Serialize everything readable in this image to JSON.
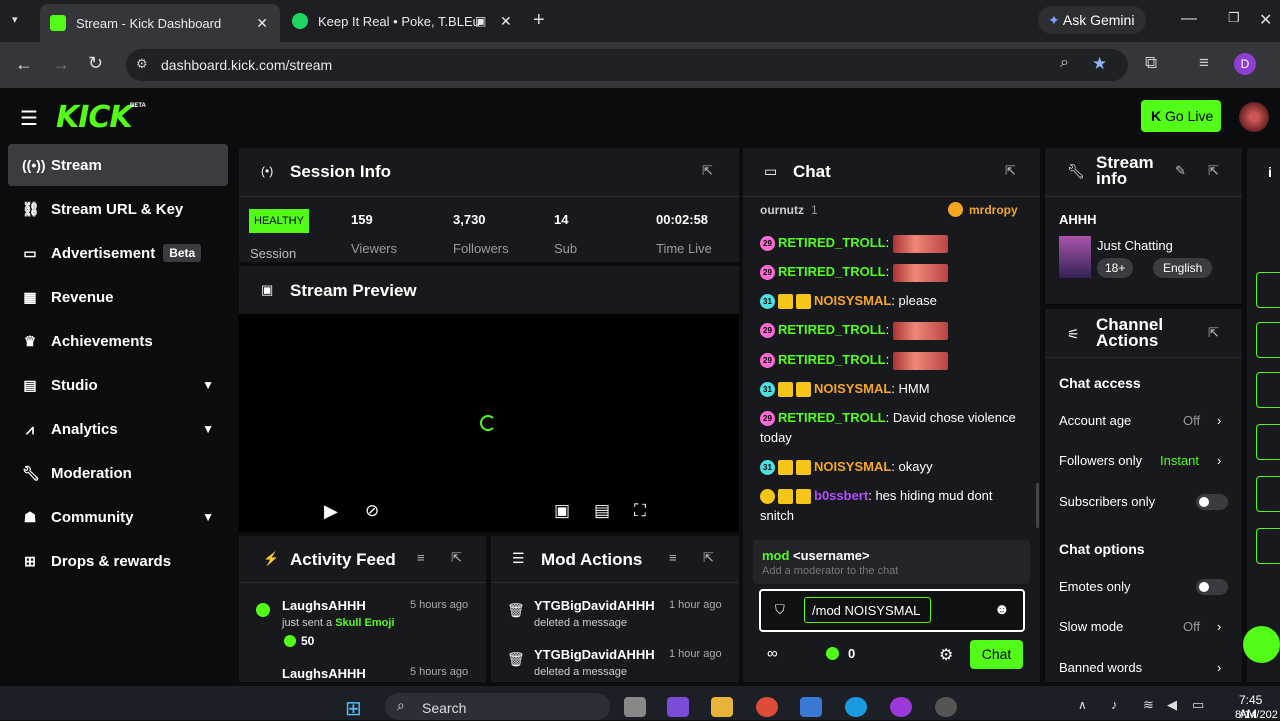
{
  "browser": {
    "tabs": [
      {
        "title": "Stream - Kick Dashboard"
      },
      {
        "title": "Keep It Real • Poke, T.BLEu"
      }
    ],
    "ask_gemini": "Ask Gemini",
    "url": "dashboard.kick.com/stream",
    "profile_initial": "D"
  },
  "header": {
    "logo": "KICK",
    "beta": "BETA",
    "go_live": "Go Live"
  },
  "sidebar": {
    "items": [
      {
        "label": "Stream",
        "icon": "broadcast-icon"
      },
      {
        "label": "Stream URL & Key",
        "icon": "link-icon"
      },
      {
        "label": "Advertisement",
        "icon": "ad-icon",
        "badge": "Beta"
      },
      {
        "label": "Revenue",
        "icon": "revenue-icon"
      },
      {
        "label": "Achievements",
        "icon": "trophy-icon"
      },
      {
        "label": "Studio",
        "icon": "studio-icon"
      },
      {
        "label": "Analytics",
        "icon": "analytics-icon"
      },
      {
        "label": "Moderation",
        "icon": "wrench-icon"
      },
      {
        "label": "Community",
        "icon": "community-icon"
      },
      {
        "label": "Drops & rewards",
        "icon": "drops-icon"
      }
    ]
  },
  "session": {
    "title": "Session Info",
    "health": "HEALTHY",
    "health_label": "Session",
    "stats": [
      {
        "value": "159",
        "label": "Viewers"
      },
      {
        "value": "3,730",
        "label": "Followers"
      },
      {
        "value": "14",
        "label": "Sub"
      },
      {
        "value": "00:02:58",
        "label": "Time Live"
      }
    ]
  },
  "preview": {
    "title": "Stream Preview"
  },
  "activity": {
    "title": "Activity Feed",
    "items": [
      {
        "user": "LaughsAHHH",
        "time": "5 hours ago",
        "text": "just sent a",
        "item": "Skull Emoji",
        "amount": "50"
      },
      {
        "user": "LaughsAHHH",
        "time": "5 hours ago"
      }
    ]
  },
  "modactions": {
    "title": "Mod Actions",
    "items": [
      {
        "user": "YTGBigDavidAHHH",
        "time": "1 hour ago",
        "text": "deleted a message"
      },
      {
        "user": "YTGBigDavidAHHH",
        "time": "1 hour ago",
        "text": "deleted a message"
      }
    ]
  },
  "chat": {
    "title": "Chat",
    "pinned_left": "ournutz",
    "pinned_count": "1",
    "pinned_right": "mrdropy",
    "messages": [
      {
        "badge": "29",
        "user": "RETIRED_TROLL",
        "text": "",
        "emote": true,
        "color": "#53fc18"
      },
      {
        "badge": "29",
        "user": "RETIRED_TROLL",
        "text": "",
        "emote": true,
        "color": "#53fc18"
      },
      {
        "badge": "31",
        "user": "NOISYSMAL",
        "text": "please",
        "color": "#f5a623"
      },
      {
        "badge": "29",
        "user": "RETIRED_TROLL",
        "text": "",
        "emote": true,
        "color": "#53fc18"
      },
      {
        "badge": "29",
        "user": "RETIRED_TROLL",
        "text": "",
        "emote": true,
        "color": "#53fc18"
      },
      {
        "badge": "31",
        "user": "NOISYSMAL",
        "text": "HMM",
        "color": "#f5a623"
      },
      {
        "badge": "29",
        "user": "RETIRED_TROLL",
        "text": "David chose violence today",
        "color": "#53fc18"
      },
      {
        "badge": "31",
        "user": "NOISYSMAL",
        "text": "okayy",
        "color": "#f5a623"
      },
      {
        "badge": "",
        "user": "b0ssbert",
        "text": "hes hiding mud dont snitch",
        "color": "#b44bff"
      }
    ],
    "suggest_cmd": "mod",
    "suggest_arg": "<username>",
    "suggest_desc": "Add a moderator to the chat",
    "input_value": "/mod NOISYSMAL",
    "count": "0",
    "send": "Chat"
  },
  "streaminfo": {
    "title": "Stream info",
    "stream_title": "AHHH",
    "category": "Just Chatting",
    "tags": [
      "18+",
      "English"
    ]
  },
  "channelactions": {
    "title": "Channel Actions",
    "chat_access": "Chat access",
    "account_age": "Account age",
    "account_age_val": "Off",
    "followers_only": "Followers only",
    "followers_only_val": "Instant",
    "subscribers_only": "Subscribers only",
    "chat_options": "Chat options",
    "emotes_only": "Emotes only",
    "slow_mode": "Slow mode",
    "slow_mode_val": "Off",
    "banned_words": "Banned words"
  },
  "taskbar": {
    "search": "Search",
    "time": "7:45 AM",
    "date": "8/14/202"
  },
  "colors": {
    "accent": "#53fc18",
    "panel": "#18191d",
    "background": "#0b0c0e"
  }
}
